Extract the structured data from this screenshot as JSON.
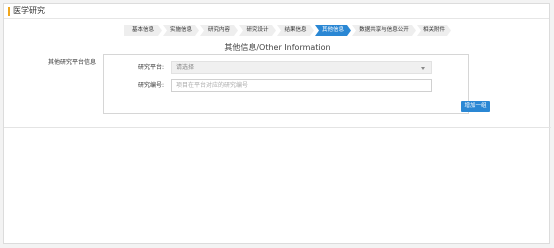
{
  "header": {
    "title": "医学研究"
  },
  "steps": [
    {
      "label": "基本信息",
      "active": false
    },
    {
      "label": "实施信息",
      "active": false
    },
    {
      "label": "研究内容",
      "active": false
    },
    {
      "label": "研究设计",
      "active": false
    },
    {
      "label": "结果信息",
      "active": false
    },
    {
      "label": "其他信息",
      "active": true
    },
    {
      "label": "数据共享与信息公开",
      "active": false
    },
    {
      "label": "相关附件",
      "active": false
    }
  ],
  "section": {
    "title": "其他信息/Other Information"
  },
  "platform_section": {
    "label": "其他研究平台信息",
    "platform_label": "研究平台:",
    "platform_select_value": "请选择",
    "number_label": "研究编号:",
    "number_placeholder": "项目在平台对应的研究编号",
    "add_button": "增加一组"
  },
  "colors": {
    "accent": "#2a87d4",
    "title_accent": "#f0a61c"
  }
}
